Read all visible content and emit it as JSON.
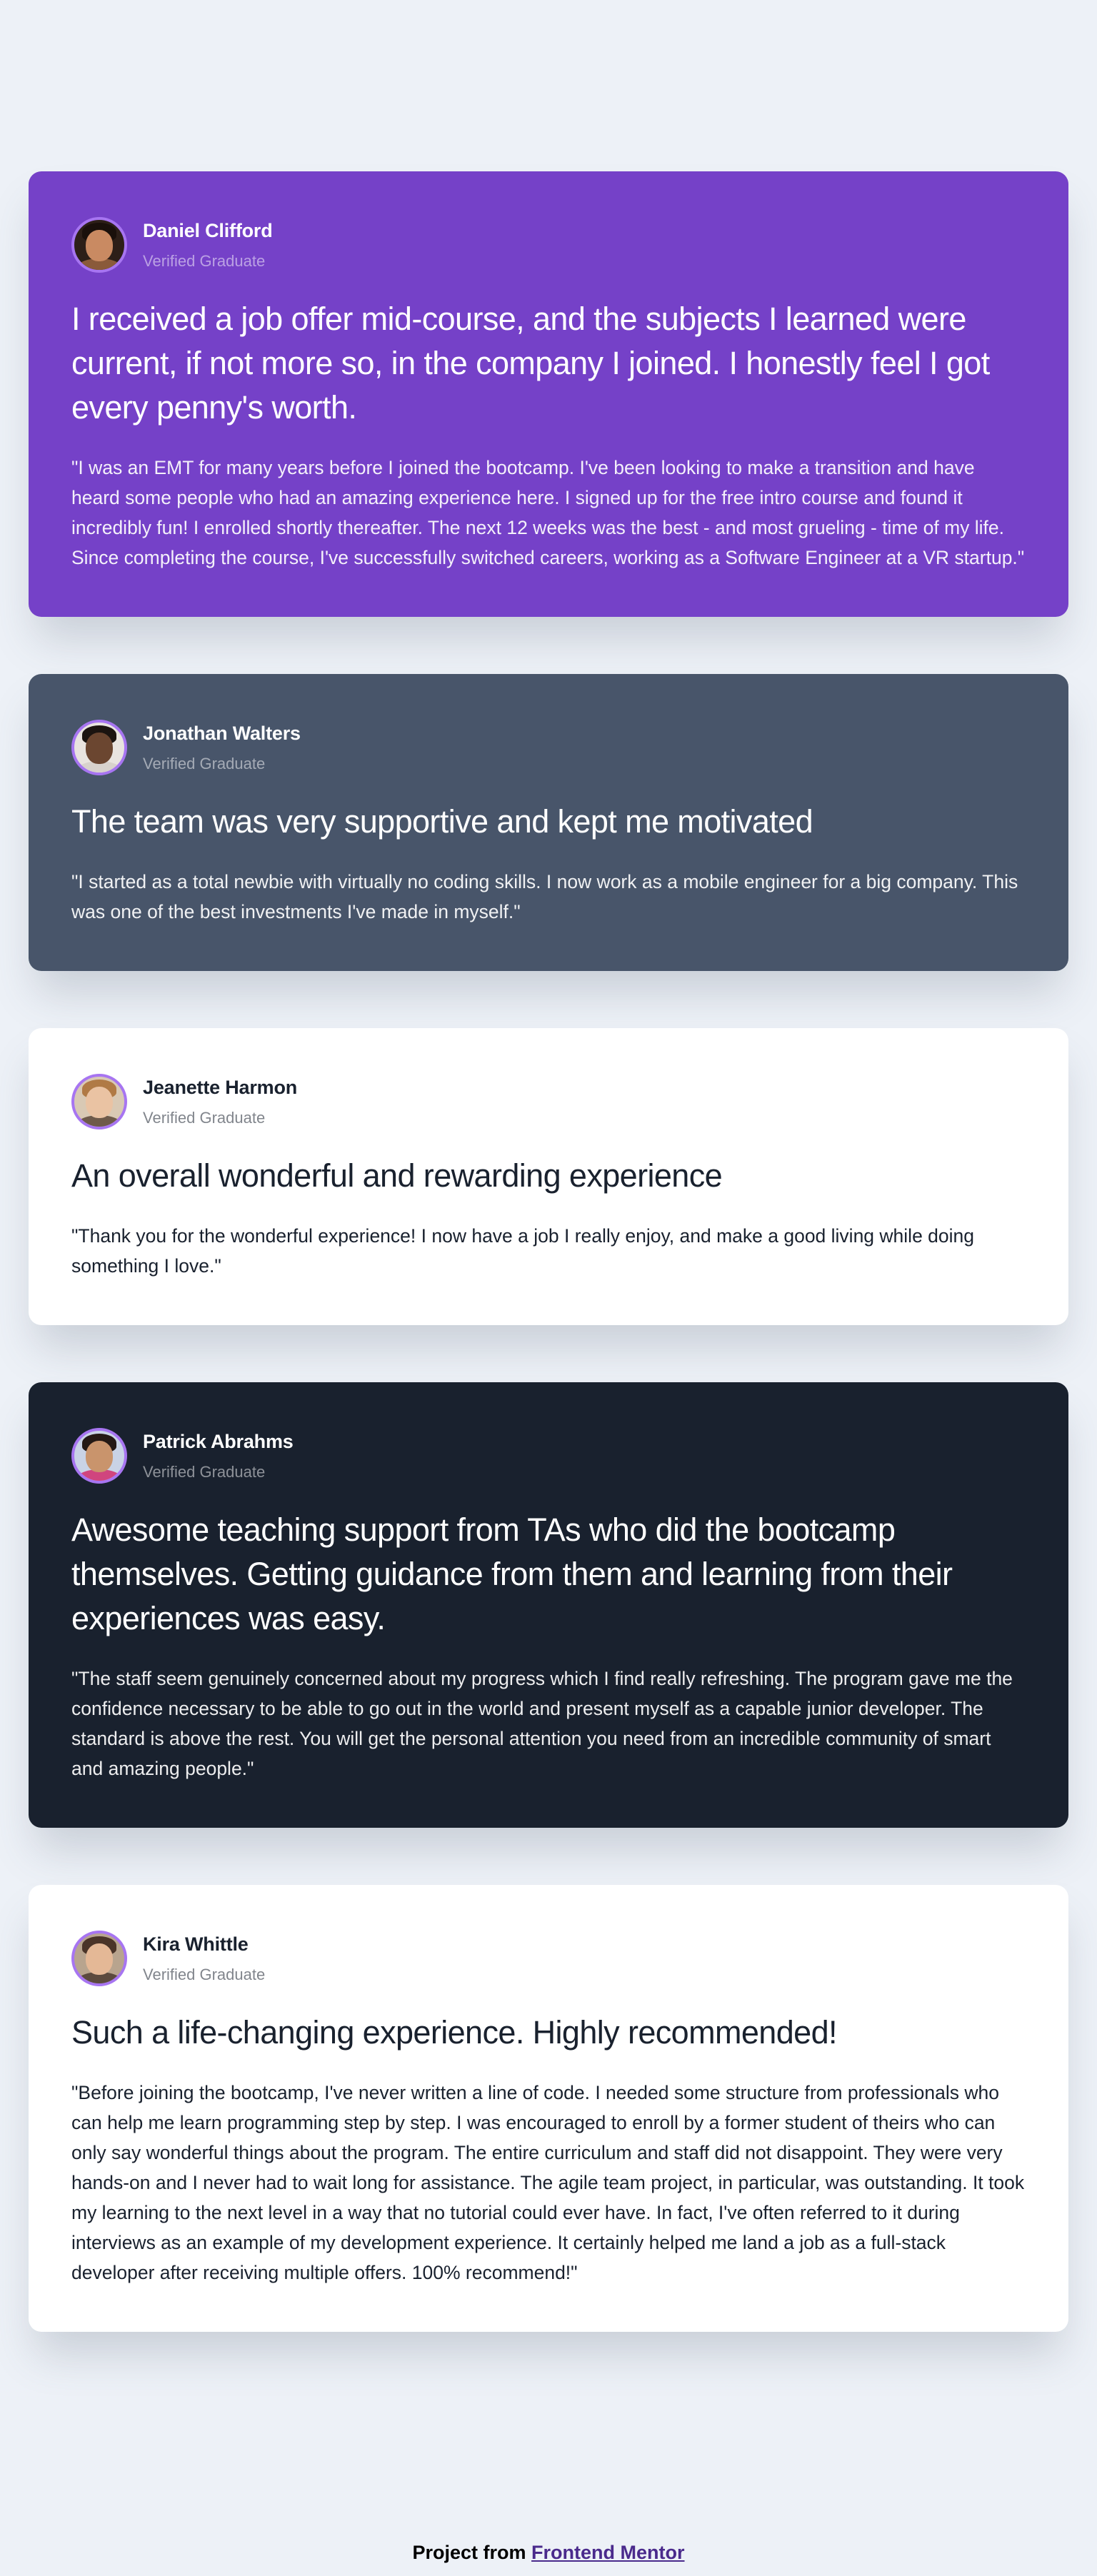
{
  "testimonials": [
    {
      "name": "Daniel Clifford",
      "role": "Verified Graduate",
      "headline": "I received a job offer mid-course, and the subjects I learned were current, if not more so, in the company I joined. I honestly feel I got every penny's worth.",
      "quote": "\"I was an EMT for many years before I joined the bootcamp. I've been looking to make a transition and have heard some people who had an amazing experience here. I signed up for the free intro course and found it incredibly fun! I enrolled shortly thereafter. The next 12 weeks was the best - and most grueling - time of my life. Since completing the course, I've successfully switched careers, working as a Software Engineer at a VR startup.\"",
      "background": "#7541c8"
    },
    {
      "name": "Jonathan Walters",
      "role": "Verified Graduate",
      "headline": "The team was very supportive and kept me motivated",
      "quote": "\"I started as a total newbie with virtually no coding skills. I now work as a mobile engineer for a big company. This was one of the best investments I've made in myself.\"",
      "background": "#48556a"
    },
    {
      "name": "Jeanette Harmon",
      "role": "Verified Graduate",
      "headline": "An overall wonderful and rewarding experience",
      "quote": "\"Thank you for the wonderful experience! I now have a job I really enjoy, and make a good living while doing something I love.\"",
      "background": "#ffffff"
    },
    {
      "name": "Patrick Abrahms",
      "role": "Verified Graduate",
      "headline": "Awesome teaching support from TAs who did the bootcamp themselves. Getting guidance from them and learning from their experiences was easy.",
      "quote": "\"The staff seem genuinely concerned about my progress which I find really refreshing. The program gave me the confidence necessary to be able to go out in the world and present myself as a capable junior developer. The standard is above the rest. You will get the personal attention you need from an incredible community of smart and amazing people.\"",
      "background": "#19212e"
    },
    {
      "name": "Kira Whittle",
      "role": "Verified Graduate",
      "headline": "Such a life-changing experience. Highly recommended!",
      "quote": "\"Before joining the bootcamp, I've never written a line of code. I needed some structure from professionals who can help me learn programming step by step. I was encouraged to enroll by a former student of theirs who can only say wonderful things about the program. The entire curriculum and staff did not disappoint. They were very hands-on and I never had to wait long for assistance. The agile team project, in particular, was outstanding. It took my learning to the next level in a way that no tutorial could ever have. In fact, I've often referred to it during interviews as an example of my development experience. It certainly helped me land a job as a full-stack developer after receiving multiple offers. 100% recommend!\"",
      "background": "#ffffff"
    }
  ],
  "footer": {
    "prefix": "Project from ",
    "link_text": "Frontend Mentor"
  },
  "colors": {
    "page_background": "#edf1f7",
    "avatar_border": "#a775f1",
    "link": "#4a2a8c"
  }
}
